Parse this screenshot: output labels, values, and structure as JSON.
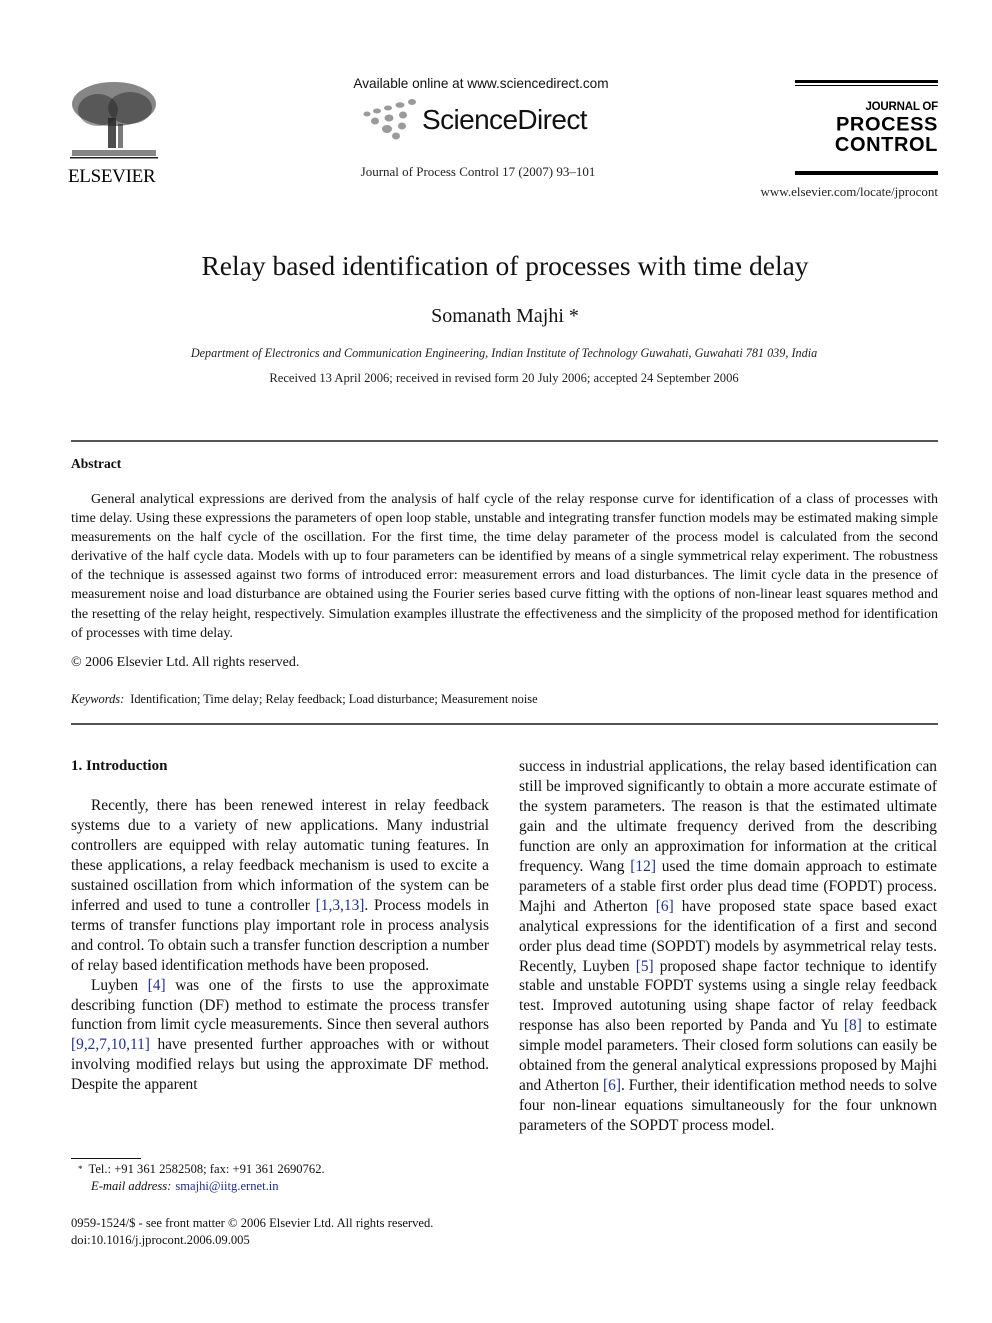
{
  "header": {
    "publisher_wordmark": "ELSEVIER",
    "available_online": "Available online at www.sciencedirect.com",
    "sciencedirect_wordmark": "ScienceDirect",
    "journal_citation": "Journal of Process Control 17 (2007) 93–101",
    "journal_logo": {
      "line1": "JOURNAL OF",
      "line2": "PROCESS",
      "line3": "CONTROL"
    },
    "journal_url": "www.elsevier.com/locate/jprocont"
  },
  "article": {
    "title": "Relay based identification of processes with time delay",
    "author": "Somanath Majhi *",
    "affiliation": "Department of Electronics and Communication Engineering, Indian Institute of Technology Guwahati, Guwahati 781 039, India",
    "dates": "Received 13 April 2006; received in revised form 20 July 2006; accepted 24 September 2006"
  },
  "abstract": {
    "heading": "Abstract",
    "body": "General analytical expressions are derived from the analysis of half cycle of the relay response curve for identification of a class of processes with time delay. Using these expressions the parameters of open loop stable, unstable and integrating transfer function models may be estimated making simple measurements on the half cycle of the oscillation. For the first time, the time delay parameter of the process model is calculated from the second derivative of the half cycle data. Models with up to four parameters can be identified by means of a single symmetrical relay experiment. The robustness of the technique is assessed against two forms of introduced error: measurement errors and load disturbances. The limit cycle data in the presence of measurement noise and load disturbance are obtained using the Fourier series based curve fitting with the options of non-linear least squares method and the resetting of the relay height, respectively. Simulation examples illustrate the effectiveness and the simplicity of the proposed method for identification of processes with time delay.",
    "copyright": "© 2006 Elsevier Ltd. All rights reserved.",
    "keywords_label": "Keywords:",
    "keywords": "Identification; Time delay; Relay feedback; Load disturbance; Measurement noise"
  },
  "introduction": {
    "heading": "1. Introduction",
    "p1": {
      "a": "Recently, there has been renewed interest in relay feedback systems due to a variety of new applications. Many industrial controllers are equipped with relay automatic tuning features. In these applications, a relay feedback mechanism is used to excite a sustained oscillation from which information of the system can be inferred and used to tune a controller ",
      "cite1": "[1,3,13]",
      "b": ". Process models in terms of transfer functions play important role in process analysis and control. To obtain such a transfer function description a number of relay based identification methods have been proposed."
    },
    "p2": {
      "a": "Luyben ",
      "cite1": "[4]",
      "b": " was one of the firsts to use the approximate describing function (DF) method to estimate the process transfer function from limit cycle measurements. Since then several authors ",
      "cite2": "[9,2,7,10,11]",
      "c": " have presented further approaches with or without involving modified relays but using the approximate DF method. Despite the apparent"
    },
    "p3": {
      "a": "success in industrial applications, the relay based identification can still be improved significantly to obtain a more accurate estimate of the system parameters. The reason is that the estimated ultimate gain and the ultimate frequency derived from the describing function are only an approximation for information at the critical frequency. Wang ",
      "cite1": "[12]",
      "b": " used the time domain approach to estimate parameters of a stable first order plus dead time (FOPDT) process. Majhi and Atherton ",
      "cite2": "[6]",
      "c": " have proposed state space based exact analytical expressions for the identification of a first and second order plus dead time (SOPDT) models by asymmetrical relay tests. Recently, Luyben ",
      "cite3": "[5]",
      "d": " proposed shape factor technique to identify stable and unstable FOPDT systems using a single relay feedback test. Improved autotuning using shape factor of relay feedback response has also been reported by Panda and Yu ",
      "cite4": "[8]",
      "e": " to estimate simple model parameters. Their closed form solutions can easily be obtained from the general analytical expressions proposed by Majhi and Atherton ",
      "cite5": "[6]",
      "f": ". Further, their identification method needs to solve four non-linear equations simultaneously for the four unknown parameters of the SOPDT process model."
    }
  },
  "footnote": {
    "star": "*",
    "contact": "Tel.: +91 361 2582508; fax: +91 361 2690762.",
    "email_label": "E-mail address:",
    "email": "smajhi@iitg.ernet.in"
  },
  "front_matter": {
    "issn": "0959-1524/$ - see front matter © 2006 Elsevier Ltd. All rights reserved.",
    "doi": "doi:10.1016/j.jprocont.2006.09.005"
  },
  "colors": {
    "citation_link": "#1f2f8f",
    "rule": "#555555"
  }
}
